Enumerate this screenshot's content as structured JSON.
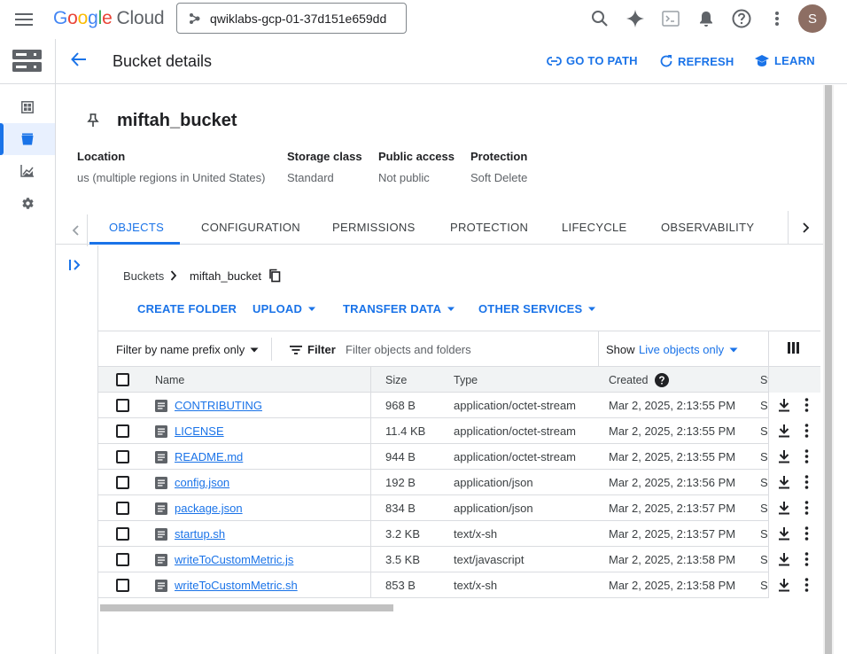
{
  "topbar": {
    "logo_google": [
      "G",
      "o",
      "o",
      "g",
      "l",
      "e"
    ],
    "logo_cloud": "Cloud",
    "project": "qwiklabs-gcp-01-37d151e659dd",
    "avatar_initial": "S"
  },
  "header": {
    "title": "Bucket details",
    "go_to_path": "GO TO PATH",
    "refresh": "REFRESH",
    "learn": "LEARN"
  },
  "bucket": {
    "name": "miftah_bucket",
    "meta": [
      {
        "label": "Location",
        "value": "us (multiple regions in United States)"
      },
      {
        "label": "Storage class",
        "value": "Standard"
      },
      {
        "label": "Public access",
        "value": "Not public"
      },
      {
        "label": "Protection",
        "value": "Soft Delete"
      }
    ]
  },
  "tabs": [
    "OBJECTS",
    "CONFIGURATION",
    "PERMISSIONS",
    "PROTECTION",
    "LIFECYCLE",
    "OBSERVABILITY"
  ],
  "breadcrumb": {
    "root": "Buckets",
    "current": "miftah_bucket"
  },
  "actions": {
    "create_folder": "CREATE FOLDER",
    "upload": "UPLOAD",
    "transfer_data": "TRANSFER DATA",
    "other_services": "OTHER SERVICES"
  },
  "filter": {
    "type": "Filter by name prefix only",
    "label": "Filter",
    "placeholder": "Filter objects and folders",
    "show_label": "Show",
    "show_value": "Live objects only"
  },
  "table": {
    "headers": {
      "name": "Name",
      "size": "Size",
      "type": "Type",
      "created": "Created",
      "storage": "St"
    },
    "rows": [
      {
        "name": "CONTRIBUTING",
        "size": "968 B",
        "type": "application/octet-stream",
        "created": "Mar 2, 2025, 2:13:55 PM",
        "storage": "S"
      },
      {
        "name": "LICENSE",
        "size": "11.4 KB",
        "type": "application/octet-stream",
        "created": "Mar 2, 2025, 2:13:55 PM",
        "storage": "S"
      },
      {
        "name": "README.md",
        "size": "944 B",
        "type": "application/octet-stream",
        "created": "Mar 2, 2025, 2:13:55 PM",
        "storage": "S"
      },
      {
        "name": "config.json",
        "size": "192 B",
        "type": "application/json",
        "created": "Mar 2, 2025, 2:13:56 PM",
        "storage": "S"
      },
      {
        "name": "package.json",
        "size": "834 B",
        "type": "application/json",
        "created": "Mar 2, 2025, 2:13:57 PM",
        "storage": "S"
      },
      {
        "name": "startup.sh",
        "size": "3.2 KB",
        "type": "text/x-sh",
        "created": "Mar 2, 2025, 2:13:57 PM",
        "storage": "S"
      },
      {
        "name": "writeToCustomMetric.js",
        "size": "3.5 KB",
        "type": "text/javascript",
        "created": "Mar 2, 2025, 2:13:58 PM",
        "storage": "S"
      },
      {
        "name": "writeToCustomMetric.sh",
        "size": "853 B",
        "type": "text/x-sh",
        "created": "Mar 2, 2025, 2:13:58 PM",
        "storage": "S"
      }
    ]
  },
  "colors": {
    "accent": "#1a73e8",
    "text": "#202124",
    "muted": "#5f6368",
    "border": "#dadce0"
  }
}
